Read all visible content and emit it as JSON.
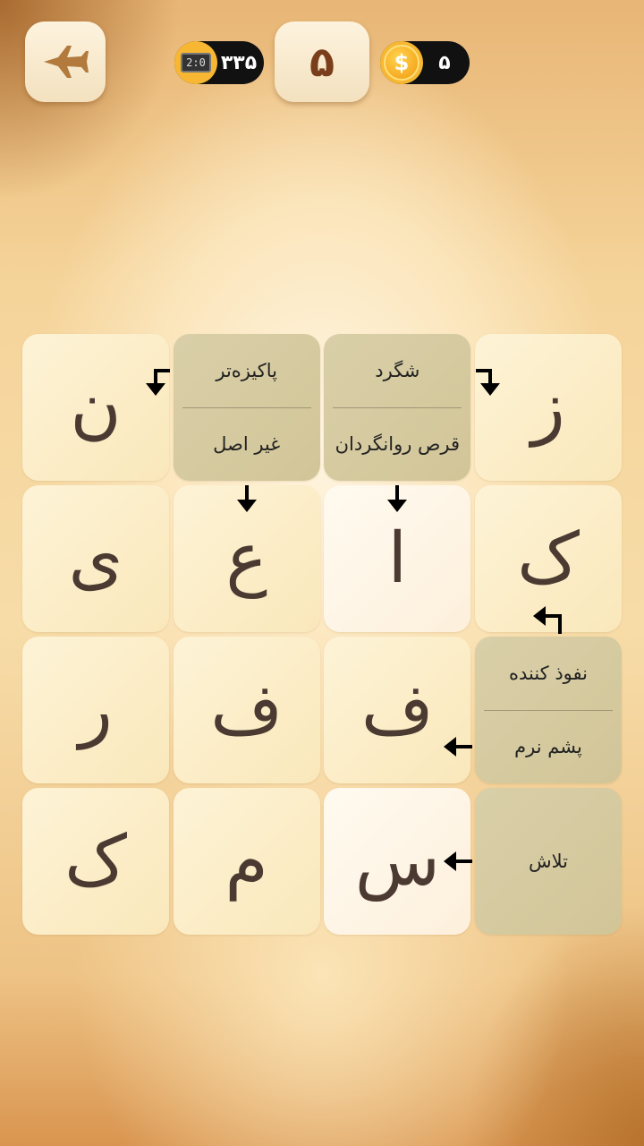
{
  "header": {
    "back_icon": "airplane-back-icon",
    "level": "۵",
    "score_value": "۳۳۵",
    "score_icon": "clock-icon",
    "clock_text": "2:0",
    "coins_value": "۵",
    "coin_icon": "coin-icon",
    "coin_symbol": "$"
  },
  "grid": {
    "rows": [
      [
        {
          "type": "letter",
          "value": "ن"
        },
        {
          "type": "clue",
          "top": "پاکیزه‌تر",
          "bottom": "غیر اصل"
        },
        {
          "type": "clue",
          "top": "شگرد",
          "bottom": "قرص روانگردان"
        },
        {
          "type": "letter",
          "value": "ز"
        }
      ],
      [
        {
          "type": "letter",
          "value": "ی"
        },
        {
          "type": "letter",
          "value": "ع"
        },
        {
          "type": "letter",
          "value": "ا",
          "active": true
        },
        {
          "type": "letter",
          "value": "ک"
        }
      ],
      [
        {
          "type": "letter",
          "value": "ر"
        },
        {
          "type": "letter",
          "value": "ف"
        },
        {
          "type": "letter",
          "value": "ف"
        },
        {
          "type": "clue",
          "top": "نفوذ کننده",
          "bottom": "پشم نرم"
        }
      ],
      [
        {
          "type": "letter",
          "value": "ک"
        },
        {
          "type": "letter",
          "value": "م"
        },
        {
          "type": "letter",
          "value": "س",
          "active": true
        },
        {
          "type": "clue",
          "top": "تلاش"
        }
      ]
    ]
  },
  "colors": {
    "clue_bg": "#d5c99e",
    "letter_bg": "#fbecc4",
    "active_bg": "#fff8ec",
    "level_text": "#7a3f1a",
    "coin": "#f7b733"
  }
}
